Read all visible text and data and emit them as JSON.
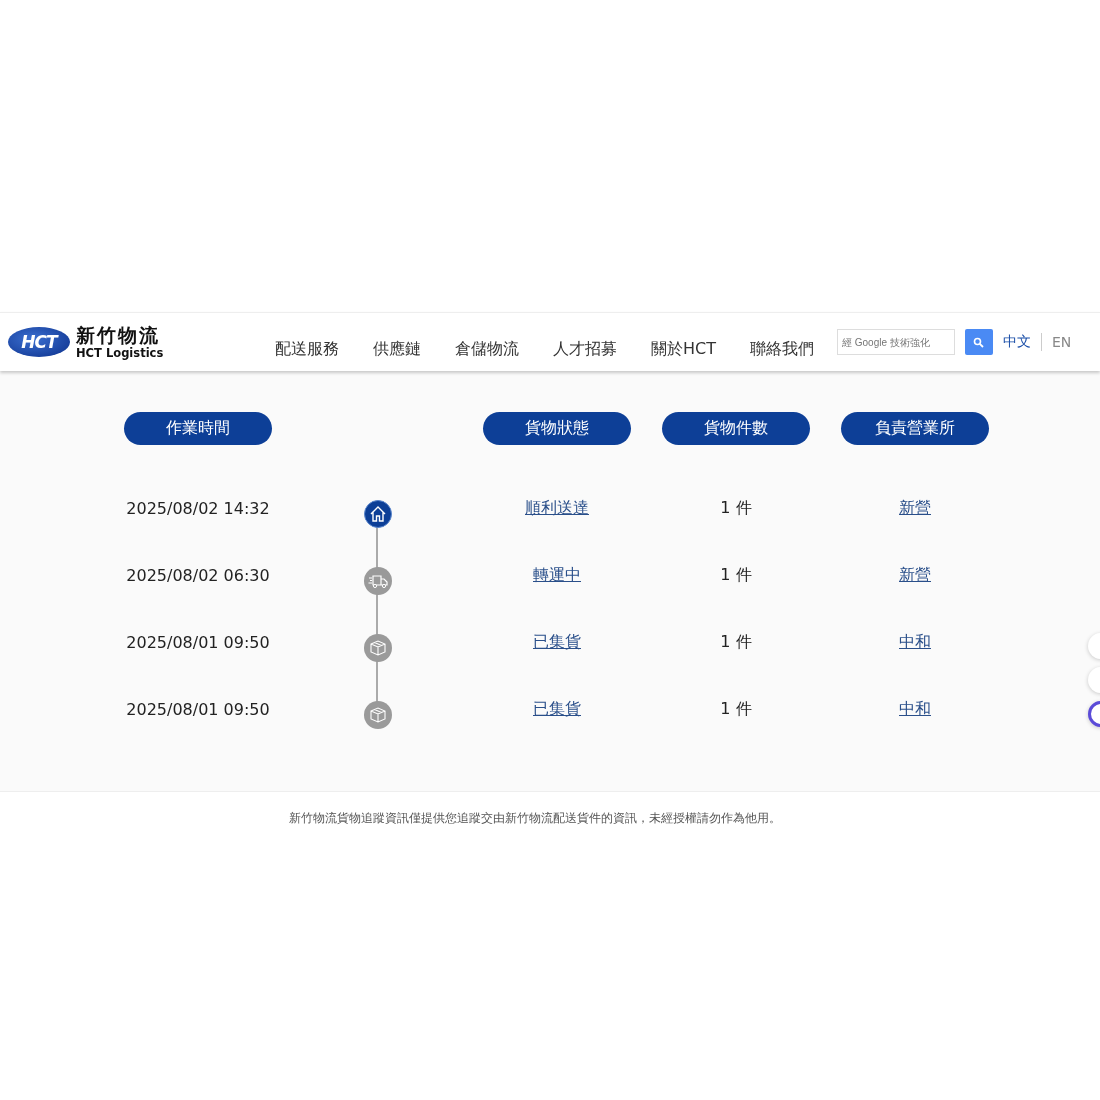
{
  "header": {
    "logo": {
      "mark": "HCT",
      "name": "新竹物流",
      "subtitle": "HCT Logistics"
    },
    "nav": [
      "配送服務",
      "供應鏈",
      "倉儲物流",
      "人才招募",
      "關於HCT",
      "聯絡我們"
    ],
    "search": {
      "placeholder": "經 Google 技術強化"
    },
    "languages": [
      {
        "label": "中文",
        "selected": true
      },
      {
        "label": "EN",
        "selected": false
      }
    ]
  },
  "tracking": {
    "columns": [
      "作業時間",
      "貨物狀態",
      "貨物件數",
      "負責營業所"
    ],
    "rows": [
      {
        "time": "2025/08/02 14:32",
        "kind": "home",
        "current": true,
        "status": "順利送達",
        "count": "1 件",
        "office": "新營"
      },
      {
        "time": "2025/08/02 06:30",
        "kind": "truck",
        "current": false,
        "status": "轉運中",
        "count": "1 件",
        "office": "新營"
      },
      {
        "time": "2025/08/01 09:50",
        "kind": "box",
        "current": false,
        "status": "已集貨",
        "count": "1 件",
        "office": "中和"
      },
      {
        "time": "2025/08/01 09:50",
        "kind": "box",
        "current": false,
        "status": "已集貨",
        "count": "1 件",
        "office": "中和"
      }
    ]
  },
  "footer": {
    "notice": "新竹物流貨物追蹤資訊僅提供您追蹤交由新竹物流配送貨件的資訊，未經授權請勿作為他用。"
  }
}
